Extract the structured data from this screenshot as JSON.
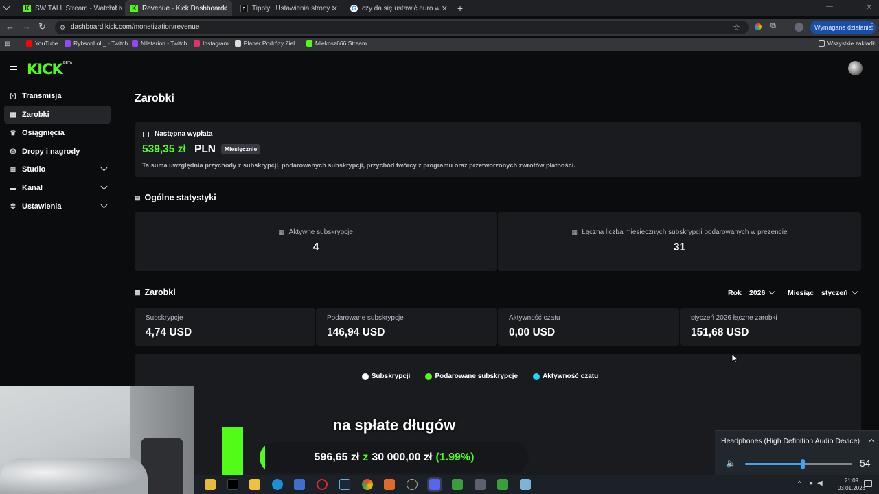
{
  "browser": {
    "tabs": [
      {
        "title": "SWITALL Stream - Watch Live o",
        "fav_color": "#53fc18",
        "fav": "K"
      },
      {
        "title": "Revenue - Kick Dashboard",
        "fav_color": "#53fc18",
        "fav": "K"
      },
      {
        "title": "Tipply | Ustawienia strony zamów",
        "fav_color": "#ffffff",
        "fav": "t"
      },
      {
        "title": "czy da się ustawić euro w tipply",
        "fav_color": "#4285f4",
        "fav": "G"
      }
    ],
    "url": "dashboard.kick.com/monetization/revenue",
    "action_required": "Wymagane działanie",
    "bookmarks": [
      {
        "label": "YouTube",
        "color": "#ff0000"
      },
      {
        "label": "RybsonLoL_ - Twitch",
        "color": "#9146ff"
      },
      {
        "label": "Nilatarion - Twitch",
        "color": "#9146ff"
      },
      {
        "label": "Instagram",
        "color": "#e1306c"
      },
      {
        "label": "Planer Podróży Ziel...",
        "color": "#dddddd"
      },
      {
        "label": "Mlekosz666 Stream...",
        "color": "#53fc18"
      }
    ],
    "all_bookmarks": "Wszystkie zakładki"
  },
  "kick": {
    "logo": "KICK",
    "beta": "BETA",
    "nav": [
      {
        "label": "Transmisja",
        "icon": "broadcast-icon",
        "glyph": "(·)",
        "chevron": false
      },
      {
        "label": "Zarobki",
        "icon": "earnings-icon",
        "glyph": "▦",
        "chevron": false
      },
      {
        "label": "Osiągnięcia",
        "icon": "trophy-icon",
        "glyph": "♛",
        "chevron": false
      },
      {
        "label": "Dropy i nagrody",
        "icon": "gift-icon",
        "glyph": "⛁",
        "chevron": false
      },
      {
        "label": "Studio",
        "icon": "studio-icon",
        "glyph": "⊞",
        "chevron": true
      },
      {
        "label": "Kanał",
        "icon": "channel-icon",
        "glyph": "▬",
        "chevron": true
      },
      {
        "label": "Ustawienia",
        "icon": "settings-icon",
        "glyph": "✲",
        "chevron": true
      }
    ],
    "page_title": "Zarobki",
    "payout": {
      "label": "Następna wypłata",
      "amount": "539,35 zł",
      "currency": "PLN",
      "badge": "Miesięcznie",
      "note": "Ta suma uwzględnia przychody z subskrypcji, podarowanych subskrypcji, przychód twórcy z programu oraz przetworzonych zwrotów płatności."
    },
    "general": {
      "title": "Ogólne statystyki",
      "active_subs_label": "Aktywne subskrypcje",
      "active_subs_value": "4",
      "gifted_total_label": "Łączna liczba miesięcznych subskrypcji podarowanych w prezencie",
      "gifted_total_value": "31"
    },
    "earnings": {
      "title": "Zarobki",
      "year_label": "Rok",
      "year_value": "2026",
      "month_label": "Miesiąc",
      "month_value": "styczeń",
      "stats": [
        {
          "label": "Subskrypcje",
          "value": "4,74 USD"
        },
        {
          "label": "Podarowane subskrypcje",
          "value": "146,94 USD"
        },
        {
          "label": "Aktywność czatu",
          "value": "0,00 USD"
        },
        {
          "label": "styczeń 2026 łączne zarobki",
          "value": "151,68 USD"
        }
      ],
      "legend": [
        {
          "label": "Subskrypcji",
          "color": "#ffffff"
        },
        {
          "label": "Podarowane subskrypcje",
          "color": "#53fc18"
        },
        {
          "label": "Aktywność czatu",
          "color": "#1fd8f0"
        }
      ]
    }
  },
  "overlay": {
    "goal_title": "na spłate długów",
    "goal_current": "596,65 zł",
    "goal_sep": "z",
    "goal_target": "30 000,00 zł",
    "goal_percent": "(1.99%)",
    "goal_fraction": 0.0199
  },
  "volume": {
    "device": "Headphones (High Definition Audio Device)",
    "level": "54",
    "level_fraction": 0.54
  },
  "clock": {
    "time": "21:09",
    "date": "03.01.2026"
  }
}
